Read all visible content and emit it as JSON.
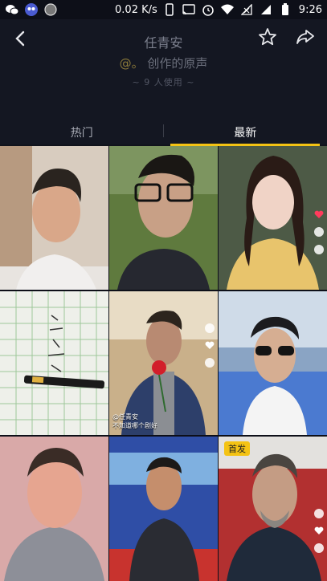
{
  "status_bar": {
    "speed": "0.02 K/s",
    "time": "9:26",
    "icons": [
      "wechat-icon",
      "app-icon",
      "app-icon-2",
      "battery-frame-icon",
      "cast-icon",
      "alarm-icon",
      "wifi-icon",
      "signal-icon",
      "sim-icon",
      "battery-icon"
    ]
  },
  "header": {
    "title": "任青安",
    "sound_prefix": "@。",
    "sound_name": "创作的原声",
    "users": "~ 9 人使用 ~"
  },
  "tabs": [
    {
      "label": "热门",
      "active": false
    },
    {
      "label": "最新",
      "active": true
    }
  ],
  "grid": {
    "cells": [
      {
        "badge": ""
      },
      {
        "badge": ""
      },
      {
        "badge": ""
      },
      {
        "badge": ""
      },
      {
        "badge": "",
        "caption_line1": "@任青安",
        "caption_line2": "不知道哪个剧好"
      },
      {
        "badge": ""
      },
      {
        "badge": ""
      },
      {
        "badge": ""
      },
      {
        "badge": "首发"
      }
    ]
  },
  "colors": {
    "accent": "#f4c314",
    "header_bg": "#141722",
    "status_bg": "#0d0f18"
  }
}
